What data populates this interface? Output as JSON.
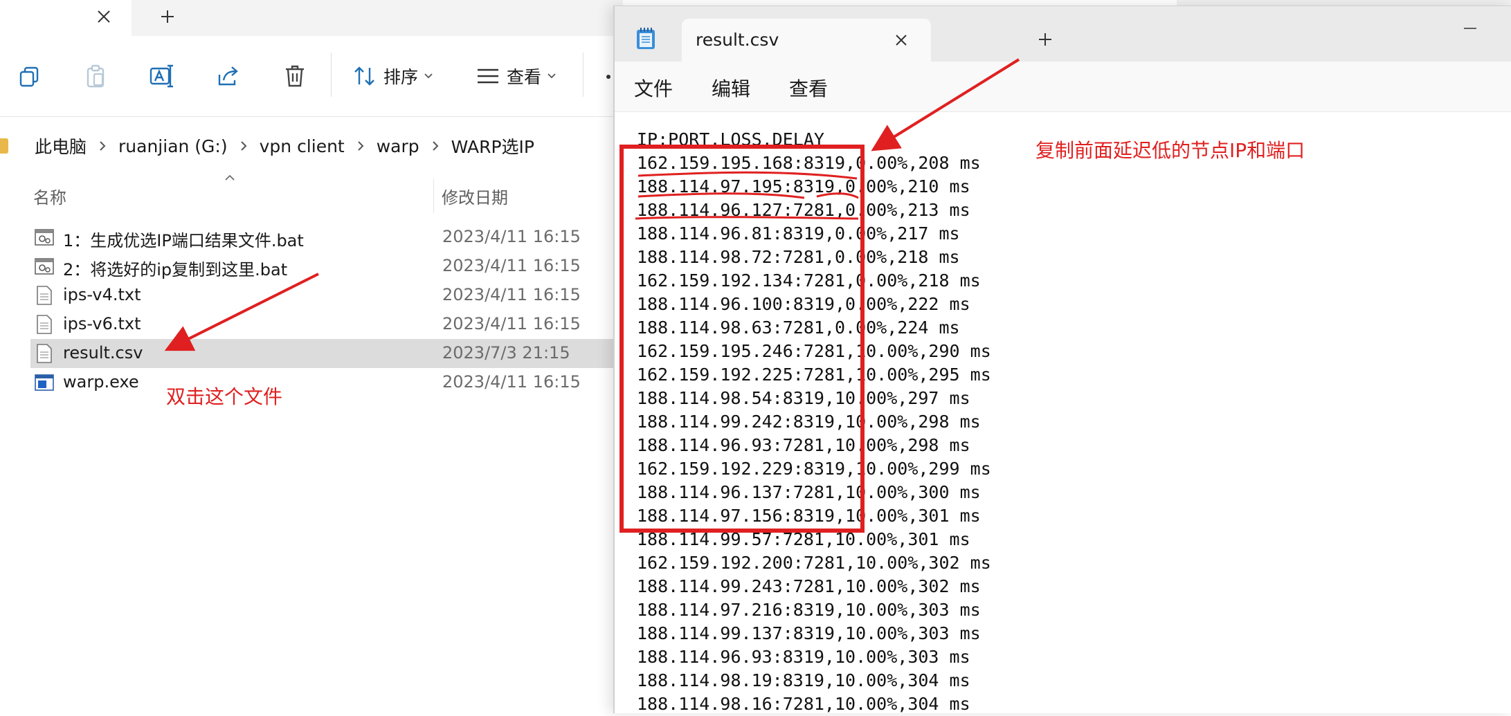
{
  "explorer": {
    "toolbar": {
      "sort_label": "排序",
      "view_label": "查看"
    },
    "breadcrumb": [
      "此电脑",
      "ruanjian (G:)",
      "vpn client",
      "warp",
      "WARP选IP"
    ],
    "columns": {
      "name": "名称",
      "date": "修改日期"
    },
    "files": [
      {
        "name": "1：生成优选IP端口结果文件.bat",
        "date": "2023/4/11 16:15",
        "icon": "bat-file-icon"
      },
      {
        "name": "2：将选好的ip复制到这里.bat",
        "date": "2023/4/11 16:15",
        "icon": "bat-file-icon"
      },
      {
        "name": "ips-v4.txt",
        "date": "2023/4/11 16:15",
        "icon": "text-file-icon"
      },
      {
        "name": "ips-v6.txt",
        "date": "2023/4/11 16:15",
        "icon": "text-file-icon"
      },
      {
        "name": "result.csv",
        "date": "2023/7/3 21:15",
        "icon": "text-file-icon",
        "selected": true
      },
      {
        "name": "warp.exe",
        "date": "2023/4/11 16:15",
        "icon": "exe-file-icon"
      }
    ]
  },
  "notepad": {
    "tab_title": "result.csv",
    "menu": [
      "文件",
      "编辑",
      "查看"
    ],
    "header_line": "IP:PORT,LOSS,DELAY",
    "lines": [
      "162.159.195.168:8319,0.00%,208 ms",
      "188.114.97.195:8319,0.00%,210 ms",
      "188.114.96.127:7281,0.00%,213 ms",
      "188.114.96.81:8319,0.00%,217 ms",
      "188.114.98.72:7281,0.00%,218 ms",
      "162.159.192.134:7281,0.00%,218 ms",
      "188.114.96.100:8319,0.00%,222 ms",
      "188.114.98.63:7281,0.00%,224 ms",
      "162.159.195.246:7281,10.00%,290 ms",
      "162.159.192.225:7281,10.00%,295 ms",
      "188.114.98.54:8319,10.00%,297 ms",
      "188.114.99.242:8319,10.00%,298 ms",
      "188.114.96.93:7281,10.00%,298 ms",
      "162.159.192.229:8319,10.00%,299 ms",
      "188.114.96.137:7281,10.00%,300 ms",
      "188.114.97.156:8319,10.00%,301 ms",
      "188.114.99.57:7281,10.00%,301 ms",
      "162.159.192.200:7281,10.00%,302 ms",
      "188.114.99.243:7281,10.00%,302 ms",
      "188.114.97.216:8319,10.00%,303 ms",
      "188.114.99.137:8319,10.00%,303 ms",
      "188.114.96.93:8319,10.00%,303 ms",
      "188.114.98.19:8319,10.00%,304 ms",
      "188.114.98.16:7281,10.00%,304 ms"
    ]
  },
  "annotations": {
    "double_click": "双击这个文件",
    "copy_hint": "复制前面延迟低的节点IP和端口",
    "color": "#e02020"
  }
}
